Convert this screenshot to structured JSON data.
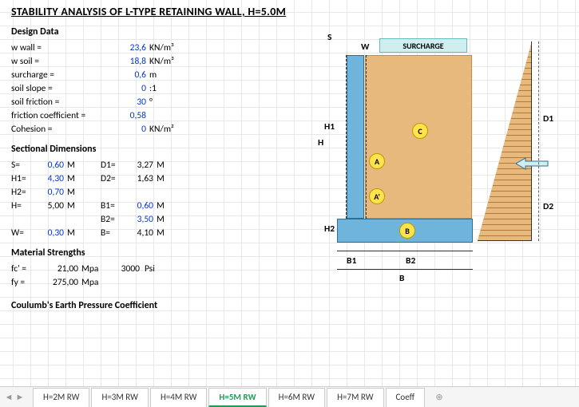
{
  "title": "STABILITY ANALYSIS OF L-TYPE RETAINING WALL, H=5.0M",
  "sections": {
    "design": "Design Data",
    "dims": "Sectional Dimensions",
    "mat": "Material Strengths",
    "coulomb": "Coulumb's Earth Pressure Coefficient"
  },
  "design": {
    "w_wall": {
      "label": "w wall =",
      "value": "23,6",
      "unit": "KN/m³"
    },
    "w_soil": {
      "label": "w soil =",
      "value": "18,8",
      "unit": "KN/m³"
    },
    "surcharge": {
      "label": "surcharge =",
      "value": "0,6",
      "unit": "m"
    },
    "slope": {
      "label": "soil slope =",
      "value": "0",
      "unit": ":1"
    },
    "friction": {
      "label": "soil friction =",
      "value": "30",
      "unit": "°"
    },
    "fcoef": {
      "label": "friction coefficient =",
      "value": "0,58",
      "unit": ""
    },
    "cohesion": {
      "label": "Cohesion =",
      "value": "0",
      "unit": "KN/m²"
    }
  },
  "dims": {
    "S": {
      "k": "S",
      "eq": "=",
      "v": "0,60",
      "u": "M"
    },
    "H1": {
      "k": "H1",
      "eq": "=",
      "v": "4,30",
      "u": "M"
    },
    "H2": {
      "k": "H2",
      "eq": "=",
      "v": "0,70",
      "u": "M"
    },
    "H": {
      "k": "H",
      "eq": "=",
      "v": "5,00",
      "u": "M"
    },
    "W": {
      "k": "W",
      "eq": "=",
      "v": "0,30",
      "u": "M"
    },
    "D1": {
      "k": "D1",
      "eq": "=",
      "v": "3,27",
      "u": "M"
    },
    "D2": {
      "k": "D2",
      "eq": "=",
      "v": "1,63",
      "u": "M"
    },
    "B1": {
      "k": "B1",
      "eq": "=",
      "v": "0,60",
      "u": "M"
    },
    "B2": {
      "k": "B2",
      "eq": "=",
      "v": "3,50",
      "u": "M"
    },
    "B": {
      "k": "B",
      "eq": "=",
      "v": "4,10",
      "u": "M"
    }
  },
  "mat": {
    "fc": {
      "k": "fc'",
      "eq": "=",
      "v": "21,00",
      "u": "Mpa",
      "psi": "3000",
      "psiu": "Psi"
    },
    "fy": {
      "k": "fy",
      "eq": "=",
      "v": "275,00",
      "u": "Mpa"
    }
  },
  "diagram": {
    "S": "S",
    "W": "W",
    "SUR": "SURCHARGE",
    "H": "H",
    "H1": "H1",
    "H2": "H2",
    "B": "B",
    "B1": "B1",
    "B2": "B2",
    "D1": "D1",
    "D2": "D2",
    "A": "A",
    "Ap": "A'",
    "Bm": "B",
    "C": "C"
  },
  "tabs": [
    "H=2M RW",
    "H=3M RW",
    "H=4M RW",
    "H=5M RW",
    "H=6M RW",
    "H=7M RW",
    "Coeff"
  ],
  "active_tab": 3
}
